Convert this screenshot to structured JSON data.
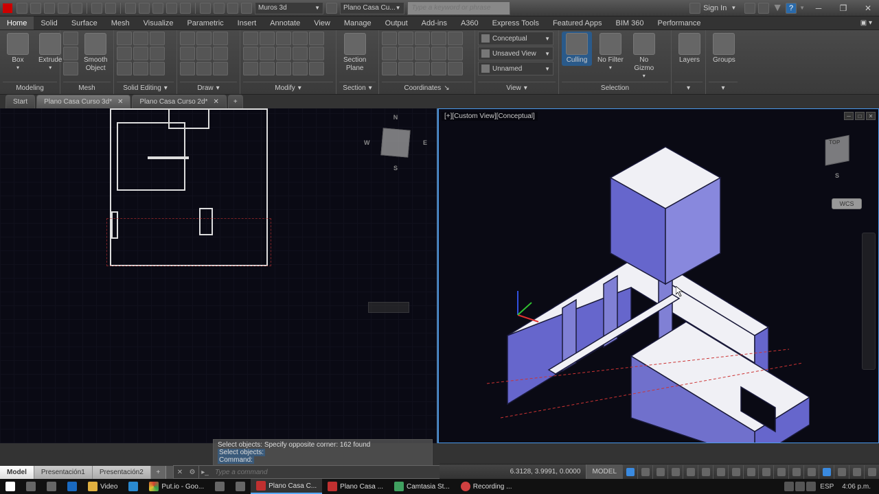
{
  "title_bar": {
    "layer_combo": "Muros 3d",
    "doc_title": "Plano Casa Cu...",
    "search_placeholder": "Type a keyword or phrase",
    "sign_in": "Sign In"
  },
  "ribbon_tabs": [
    "Home",
    "Solid",
    "Surface",
    "Mesh",
    "Visualize",
    "Parametric",
    "Insert",
    "Annotate",
    "View",
    "Manage",
    "Output",
    "Add-ins",
    "A360",
    "Express Tools",
    "Featured Apps",
    "BIM 360",
    "Performance"
  ],
  "active_ribbon_tab": "Home",
  "panels": {
    "modeling": {
      "title": "Modeling",
      "items": [
        "Box",
        "Extrude"
      ]
    },
    "mesh": {
      "title": "Mesh",
      "item": "Smooth\nObject"
    },
    "solid_editing": {
      "title": "Solid Editing"
    },
    "draw": {
      "title": "Draw"
    },
    "modify": {
      "title": "Modify"
    },
    "section": {
      "title": "Section",
      "item": "Section\nPlane"
    },
    "coordinates": {
      "title": "Coordinates"
    },
    "view": {
      "title": "View",
      "visual_style": "Conceptual",
      "saved_view": "Unsaved View",
      "ucs_name": "Unnamed"
    },
    "selection": {
      "title": "Selection",
      "culling": "Culling",
      "no_filter": "No Filter",
      "no_gizmo": "No\nGizmo"
    },
    "layers": {
      "title": "",
      "item": "Layers"
    },
    "groups": {
      "title": "",
      "item": "Groups"
    }
  },
  "file_tabs": [
    {
      "label": "Start",
      "dirty": false
    },
    {
      "label": "Plano Casa Curso 3d",
      "dirty": true
    },
    {
      "label": "Plano Casa Curso 2d",
      "dirty": true
    }
  ],
  "viewport": {
    "right_label": "[+][Custom View][Conceptual]",
    "compass": {
      "n": "N",
      "s": "S",
      "e": "E",
      "w": "W"
    },
    "wcs": "WCS",
    "cube_face": "TOP"
  },
  "command": {
    "history": [
      "Select objects: Specify opposite corner: 162 found",
      "Select objects:",
      "Command:"
    ],
    "placeholder": "Type a command"
  },
  "layout_tabs": [
    "Model",
    "Presentación1",
    "Presentación2"
  ],
  "status": {
    "coords": "6.3128, 3.9991, 0.0000",
    "space": "MODEL"
  },
  "taskbar": {
    "items": [
      "",
      "",
      "",
      "",
      "Video",
      "",
      "",
      "Put.io - Goo...",
      "",
      "",
      "",
      "Plano Casa C...",
      "",
      "Plano Casa ...",
      "",
      "Camtasia St...",
      "",
      "Recording ..."
    ],
    "lang": "ESP",
    "clock": "4:06 p.m."
  }
}
